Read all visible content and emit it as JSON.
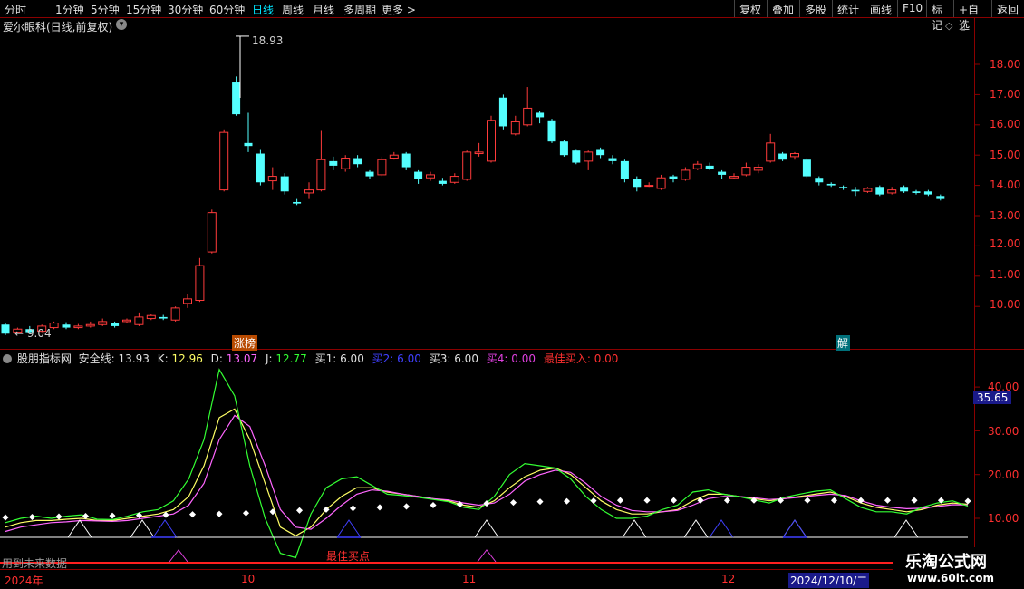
{
  "toolbar": {
    "periods": [
      "分时",
      "1分钟",
      "5分钟",
      "15分钟",
      "30分钟",
      "60分钟",
      "日线",
      "周线",
      "月线",
      "多周期",
      "更多 >"
    ],
    "active_period": "日线",
    "right_buttons": [
      "复权",
      "叠加",
      "多股",
      "统计",
      "画线",
      "F10",
      "标记",
      "+自选",
      "返回"
    ]
  },
  "stock": {
    "title": "爱尔眼科(日线,前复权)",
    "high_label": "18.93",
    "low_label": "← 9.04",
    "tag_zhangbang": "涨榜",
    "tag_jie": "解"
  },
  "price_axis": [
    "18.00",
    "17.00",
    "16.00",
    "15.00",
    "14.00",
    "13.00",
    "12.00",
    "11.00",
    "10.00"
  ],
  "indicator": {
    "name": "股朋指标网",
    "safe_label": "安全线:",
    "safe_value": "13.93",
    "k_label": "K:",
    "k_value": "12.96",
    "d_label": "D:",
    "d_value": "13.07",
    "j_label": "J:",
    "j_value": "12.77",
    "b1_label": "买1:",
    "b1_value": "6.00",
    "b2_label": "买2:",
    "b2_value": "6.00",
    "b3_label": "买3:",
    "b3_value": "6.00",
    "b4_label": "买4:",
    "b4_value": "0.00",
    "best_label": "最佳买入:",
    "best_value": "0.00",
    "axis": [
      "40.00",
      "30.00",
      "20.00",
      "10.00"
    ],
    "current_value": "35.65",
    "best_point_label": "最佳买点",
    "future_note": "用到未来数据"
  },
  "date_axis": {
    "labels": [
      "2024年",
      "10",
      "11",
      "12"
    ],
    "cursor_date": "2024/12/10/二"
  },
  "watermark": {
    "line1": "乐淘公式网",
    "line2": "www.60lt.com"
  },
  "colors": {
    "up": "#ff3b3b",
    "down": "#54ffff",
    "k_line": "#ffff66",
    "d_line": "#ff66ff",
    "j_line": "#33ff33",
    "safe_dots": "#ffffff",
    "buy2": "#4040ff",
    "buy4": "#e040e0",
    "border": "#8b0000"
  },
  "chart_data": [
    {
      "type": "candlestick",
      "title": "爱尔眼科(日线,前复权)",
      "ylim": [
        9.0,
        19.0
      ],
      "max_marked": 18.93,
      "min_marked": 9.04,
      "candles": [
        [
          9.4,
          9.1,
          9.45,
          9.05
        ],
        [
          9.15,
          9.25,
          9.3,
          9.1
        ],
        [
          9.25,
          9.15,
          9.35,
          9.1
        ],
        [
          9.18,
          9.35,
          9.4,
          9.15
        ],
        [
          9.3,
          9.45,
          9.5,
          9.25
        ],
        [
          9.4,
          9.3,
          9.48,
          9.25
        ],
        [
          9.3,
          9.35,
          9.42,
          9.25
        ],
        [
          9.35,
          9.4,
          9.5,
          9.3
        ],
        [
          9.4,
          9.5,
          9.6,
          9.35
        ],
        [
          9.45,
          9.35,
          9.5,
          9.3
        ],
        [
          9.5,
          9.55,
          9.6,
          9.45
        ],
        [
          9.4,
          9.65,
          9.8,
          9.35
        ],
        [
          9.6,
          9.7,
          9.75,
          9.55
        ],
        [
          9.65,
          9.6,
          9.72,
          9.55
        ],
        [
          9.55,
          9.95,
          10.0,
          9.5
        ],
        [
          10.1,
          10.25,
          10.4,
          9.95
        ],
        [
          10.2,
          11.35,
          11.6,
          10.15
        ],
        [
          11.8,
          13.1,
          13.2,
          11.75
        ],
        [
          13.85,
          15.75,
          15.85,
          13.8
        ],
        [
          17.4,
          16.35,
          17.6,
          16.3
        ],
        [
          15.4,
          15.3,
          16.4,
          15.1
        ],
        [
          15.05,
          14.1,
          15.2,
          14.0
        ],
        [
          14.15,
          14.3,
          14.6,
          13.85
        ],
        [
          14.3,
          13.8,
          14.4,
          13.7
        ],
        [
          13.45,
          13.4,
          13.55,
          13.35
        ],
        [
          13.75,
          13.85,
          14.1,
          13.55
        ],
        [
          13.85,
          14.85,
          15.8,
          13.8
        ],
        [
          14.8,
          14.65,
          14.95,
          14.5
        ],
        [
          14.55,
          14.9,
          15.0,
          14.45
        ],
        [
          14.9,
          14.7,
          15.0,
          14.6
        ],
        [
          14.45,
          14.3,
          14.5,
          14.2
        ],
        [
          14.35,
          14.85,
          14.95,
          14.3
        ],
        [
          14.9,
          15.0,
          15.1,
          14.85
        ],
        [
          15.05,
          14.6,
          15.1,
          14.5
        ],
        [
          14.45,
          14.2,
          14.5,
          14.05
        ],
        [
          14.25,
          14.35,
          14.45,
          14.15
        ],
        [
          14.15,
          14.05,
          14.25,
          14.0
        ],
        [
          14.1,
          14.3,
          14.4,
          14.05
        ],
        [
          14.2,
          15.1,
          15.15,
          14.15
        ],
        [
          15.05,
          15.1,
          15.4,
          14.95
        ],
        [
          14.8,
          16.15,
          16.3,
          14.75
        ],
        [
          16.9,
          15.95,
          17.0,
          15.85
        ],
        [
          15.7,
          16.1,
          16.3,
          15.65
        ],
        [
          16.0,
          16.55,
          17.25,
          15.95
        ],
        [
          16.4,
          16.25,
          16.45,
          16.05
        ],
        [
          16.15,
          15.45,
          16.2,
          15.4
        ],
        [
          15.45,
          15.0,
          15.5,
          14.95
        ],
        [
          15.15,
          14.75,
          15.2,
          14.7
        ],
        [
          14.8,
          15.1,
          15.15,
          14.5
        ],
        [
          15.2,
          15.0,
          15.25,
          14.9
        ],
        [
          14.9,
          14.8,
          15.0,
          14.7
        ],
        [
          14.8,
          14.2,
          14.85,
          14.1
        ],
        [
          14.2,
          13.95,
          14.3,
          13.8
        ],
        [
          14.0,
          14.0,
          14.1,
          13.95
        ],
        [
          13.9,
          14.25,
          14.35,
          13.85
        ],
        [
          14.3,
          14.2,
          14.35,
          14.1
        ],
        [
          14.2,
          14.5,
          14.6,
          14.15
        ],
        [
          14.55,
          14.7,
          14.8,
          14.5
        ],
        [
          14.65,
          14.55,
          14.75,
          14.5
        ],
        [
          14.45,
          14.35,
          14.5,
          14.2
        ],
        [
          14.25,
          14.3,
          14.4,
          14.2
        ],
        [
          14.35,
          14.6,
          14.75,
          14.3
        ],
        [
          14.5,
          14.6,
          14.7,
          14.4
        ],
        [
          14.8,
          15.4,
          15.7,
          14.75
        ],
        [
          15.05,
          14.85,
          15.1,
          14.8
        ],
        [
          14.95,
          15.05,
          15.1,
          14.85
        ],
        [
          14.85,
          14.3,
          14.9,
          14.25
        ],
        [
          14.25,
          14.1,
          14.3,
          14.0
        ],
        [
          14.05,
          14.0,
          14.1,
          13.95
        ],
        [
          13.95,
          13.9,
          14.0,
          13.85
        ],
        [
          13.85,
          13.8,
          13.95,
          13.65
        ],
        [
          13.8,
          13.9,
          13.95,
          13.75
        ],
        [
          13.95,
          13.7,
          14.0,
          13.65
        ],
        [
          13.75,
          13.85,
          13.95,
          13.7
        ],
        [
          13.95,
          13.8,
          14.0,
          13.75
        ],
        [
          13.8,
          13.75,
          13.85,
          13.7
        ],
        [
          13.8,
          13.7,
          13.85,
          13.65
        ],
        [
          13.65,
          13.55,
          13.7,
          13.5
        ]
      ]
    },
    {
      "type": "line",
      "title": "股朋指标网",
      "ylim": [
        0,
        48
      ],
      "series": [
        {
          "name": "K",
          "values": [
            8,
            9,
            9.5,
            9.5,
            9.8,
            10,
            9.5,
            9.5,
            10,
            10.5,
            11,
            12,
            15,
            22,
            33,
            35,
            28,
            18,
            8,
            6,
            8,
            12,
            15,
            17,
            17,
            16,
            15.5,
            15,
            14.5,
            14,
            13,
            12.5,
            14,
            17,
            19.5,
            21,
            21.5,
            20,
            17,
            14,
            12,
            11,
            11,
            11.5,
            12,
            14,
            15.5,
            15.5,
            15,
            14.5,
            14,
            14.5,
            15,
            15.5,
            16,
            15,
            13.5,
            12.5,
            12,
            11.5,
            12,
            13,
            13.5,
            13.2
          ]
        },
        {
          "name": "D",
          "values": [
            7,
            8,
            8.5,
            9,
            9.2,
            9.5,
            9.4,
            9.3,
            9.5,
            10,
            10.5,
            11,
            13,
            18,
            28,
            33.5,
            31,
            22,
            12,
            8,
            7.5,
            10,
            13,
            15.5,
            16.5,
            16.2,
            15.5,
            15,
            14.5,
            14.2,
            13.5,
            13,
            13.5,
            15.5,
            18.5,
            20,
            21,
            20.5,
            18,
            15,
            13,
            11.8,
            11.5,
            11.5,
            11.8,
            13,
            14.5,
            15,
            15,
            14.7,
            14.3,
            14.5,
            14.8,
            15.2,
            15.5,
            15.2,
            14,
            13,
            12.5,
            12.2,
            12.3,
            12.7,
            13.1,
            13.07
          ]
        },
        {
          "name": "J",
          "values": [
            9,
            10,
            10.5,
            10,
            10.5,
            10.8,
            9.8,
            9.7,
            10.5,
            11.5,
            12,
            14,
            19,
            28,
            44,
            38,
            22,
            10,
            2,
            1,
            11,
            17,
            19,
            19.5,
            17.5,
            15.5,
            15.2,
            14.8,
            14.3,
            13.8,
            12.5,
            12,
            15,
            20,
            22.5,
            22,
            21.5,
            19,
            15,
            12,
            10,
            10,
            10.5,
            12,
            13,
            16,
            16.5,
            15.5,
            15,
            14.2,
            13.5,
            14.8,
            15.5,
            16.2,
            16.5,
            14.5,
            12.5,
            11.5,
            11.5,
            11,
            12.5,
            13.5,
            14,
            12.77
          ]
        },
        {
          "name": "安全线",
          "values": [
            10.2,
            10.3,
            10.4,
            10.5,
            10.6,
            10.7,
            10.8,
            10.9,
            11,
            11.2,
            11.5,
            11.8,
            12,
            12.3,
            12.5,
            12.7,
            13,
            13.2,
            13.4,
            13.6,
            13.8,
            13.9,
            14,
            14.1,
            14.1,
            14.1,
            14.1,
            14.1,
            14.1,
            14.1,
            14.1,
            14.1,
            14.1,
            14.1,
            14.1,
            14.1,
            13.93
          ]
        }
      ]
    }
  ]
}
